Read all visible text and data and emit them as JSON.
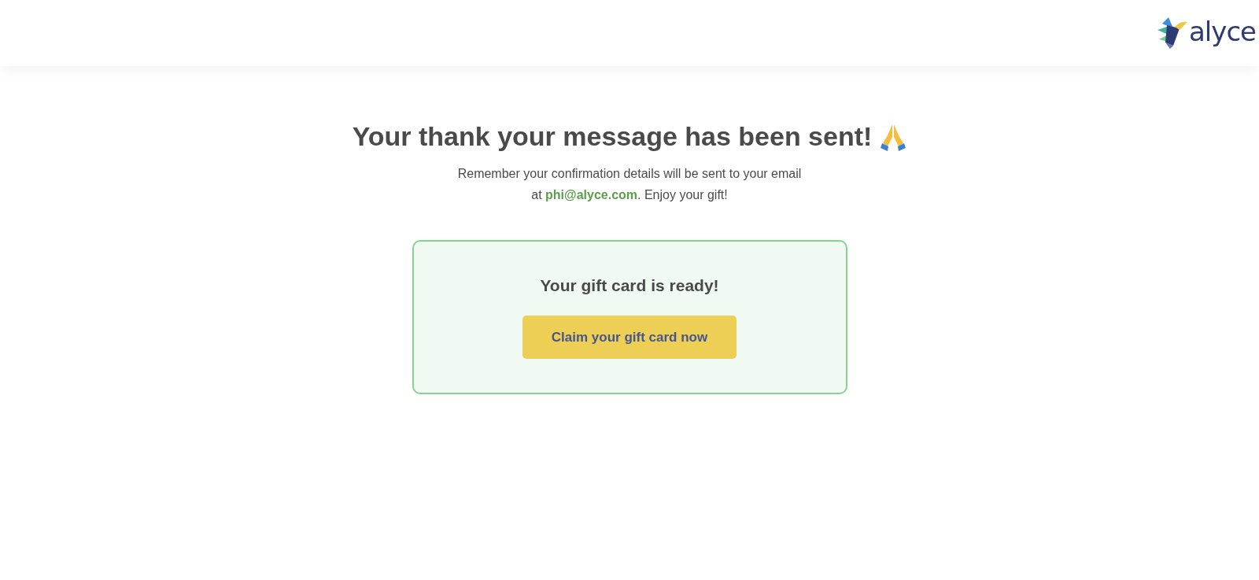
{
  "header": {
    "logo_text": "alyce"
  },
  "heading": "Your thank your message has been sent!",
  "message": "Remember your confirmation details will be sent to your email at **phi@alyce.com**. Enjoy your gift!",
  "card": {
    "title": "Your gift card is ready!",
    "button": "Claim your gift card now"
  }
}
